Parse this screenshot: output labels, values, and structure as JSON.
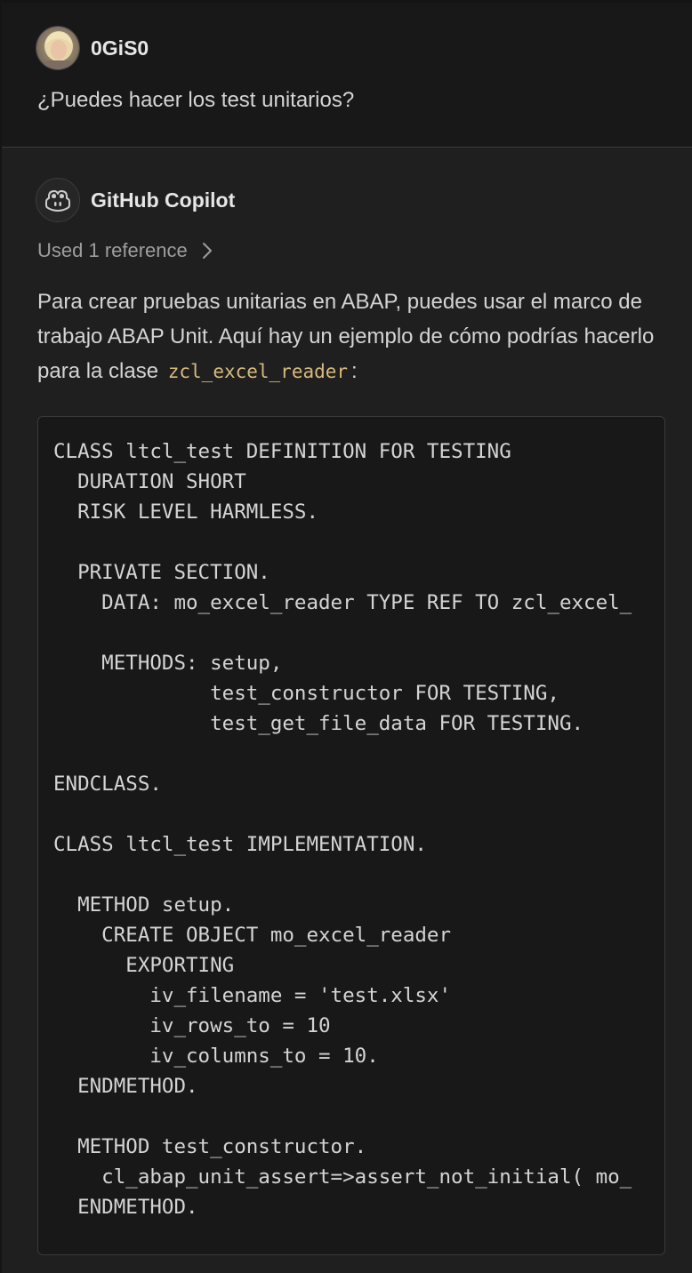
{
  "request": {
    "username": "0GiS0",
    "message": "¿Puedes hacer los test unitarios?",
    "avatar_icon": "user-avatar-photo"
  },
  "response": {
    "agent_name": "GitHub Copilot",
    "agent_icon": "copilot-icon",
    "references_label": "Used 1 reference",
    "paragraph_part1": "Para crear pruebas unitarias en ABAP, puedes usar el marco de trabajo ABAP Unit. Aquí hay un ejemplo de cómo podrías hacerlo para la clase",
    "inline_code": "zcl_excel_reader",
    "paragraph_end": ":",
    "code_lines": [
      "CLASS ltcl_test DEFINITION FOR TESTING",
      "  DURATION SHORT",
      "  RISK LEVEL HARMLESS.",
      "",
      "  PRIVATE SECTION.",
      "    DATA: mo_excel_reader TYPE REF TO zcl_excel_",
      "",
      "    METHODS: setup,",
      "             test_constructor FOR TESTING,",
      "             test_get_file_data FOR TESTING.",
      "",
      "ENDCLASS.",
      "",
      "CLASS ltcl_test IMPLEMENTATION.",
      "",
      "  METHOD setup.",
      "    CREATE OBJECT mo_excel_reader",
      "      EXPORTING",
      "        iv_filename = 'test.xlsx'",
      "        iv_rows_to = 10",
      "        iv_columns_to = 10.",
      "  ENDMETHOD.",
      "",
      "  METHOD test_constructor.",
      "    cl_abap_unit_assert=>assert_not_initial( mo_",
      "  ENDMETHOD.",
      ""
    ]
  },
  "colors": {
    "background": "#1f1f1f",
    "request_background": "#181818",
    "inline_code": "#d7ba7d",
    "text": "#d4d4d4",
    "muted": "#9d9d9d"
  }
}
